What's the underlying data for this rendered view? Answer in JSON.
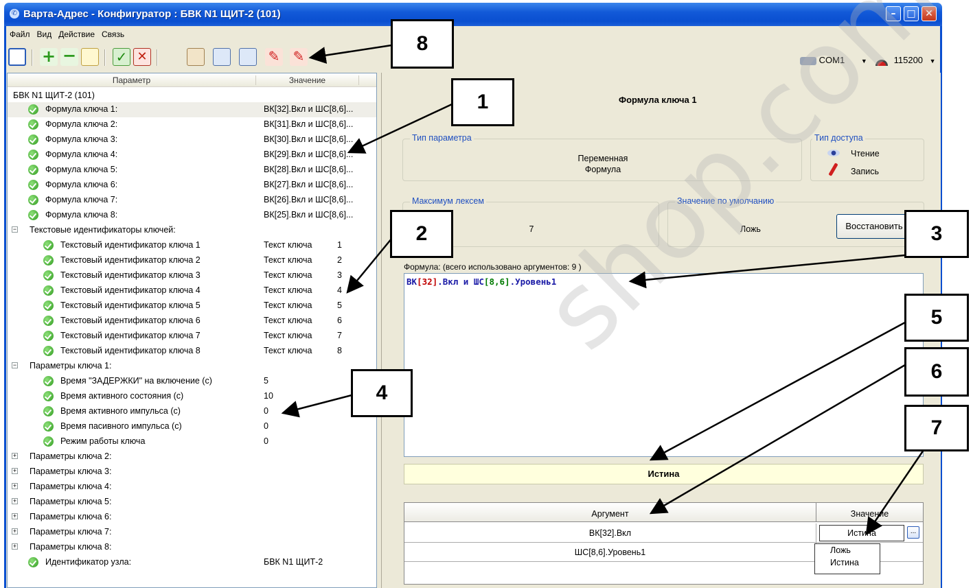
{
  "window": {
    "title": "Варта-Адрес - Конфигуратор : БВК N1 ЩИТ-2 (101)"
  },
  "menu": [
    "Файл",
    "Вид",
    "Действие",
    "Связь"
  ],
  "toolbar": {
    "icons": [
      "save-icon",
      "add-icon",
      "remove-icon",
      "list-icon",
      "check-icon",
      "cancel-icon",
      "import-icon",
      "view-icon",
      "view-all-icon",
      "write-icon",
      "write-all-icon"
    ],
    "port": "COM1",
    "speed": "115200"
  },
  "tree": {
    "header": {
      "param": "Параметр",
      "value": "Значение"
    },
    "root": "БВК N1 ЩИТ-2 (101)",
    "formulas": [
      {
        "label": "Формула ключа 1:",
        "value": "ВК[32].Вкл и ШС[8,6]..."
      },
      {
        "label": "Формула ключа 2:",
        "value": "ВК[31].Вкл и ШС[8,6]..."
      },
      {
        "label": "Формула ключа 3:",
        "value": "ВК[30].Вкл и ШС[8,6]..."
      },
      {
        "label": "Формула ключа 4:",
        "value": "ВК[29].Вкл и ШС[8,6]..."
      },
      {
        "label": "Формула ключа 5:",
        "value": "ВК[28].Вкл и ШС[8,6]..."
      },
      {
        "label": "Формула ключа 6:",
        "value": "ВК[27].Вкл и ШС[8,6]..."
      },
      {
        "label": "Формула ключа 7:",
        "value": "ВК[26].Вкл и ШС[8,6]..."
      },
      {
        "label": "Формула ключа 8:",
        "value": "ВК[25].Вкл и ШС[8,6]..."
      }
    ],
    "text_ids_group": "Текстовые идентификаторы ключей:",
    "text_ids": [
      {
        "label": "Текстовый идентификатор ключа 1",
        "value": "Текст ключа",
        "num": "1"
      },
      {
        "label": "Текстовый идентификатор ключа 2",
        "value": "Текст ключа",
        "num": "2"
      },
      {
        "label": "Текстовый идентификатор ключа 3",
        "value": "Текст ключа",
        "num": "3"
      },
      {
        "label": "Текстовый идентификатор ключа 4",
        "value": "Текст ключа",
        "num": "4"
      },
      {
        "label": "Текстовый идентификатор ключа 5",
        "value": "Текст ключа",
        "num": "5"
      },
      {
        "label": "Текстовый идентификатор ключа 6",
        "value": "Текст ключа",
        "num": "6"
      },
      {
        "label": "Текстовый идентификатор ключа 7",
        "value": "Текст ключа",
        "num": "7"
      },
      {
        "label": "Текстовый идентификатор ключа 8",
        "value": "Текст ключа",
        "num": "8"
      }
    ],
    "key1_group": "Параметры ключа 1:",
    "key1_params": [
      {
        "label": "Время \"ЗАДЕРЖКИ\"  на включение (с)",
        "value": "5"
      },
      {
        "label": "Время активного состояния (с)",
        "value": "10"
      },
      {
        "label": "Время активного импульса (с)",
        "value": "0"
      },
      {
        "label": "Время пасивного импульса (с)",
        "value": "0"
      },
      {
        "label": "Режим работы ключа",
        "value": "0"
      }
    ],
    "collapsed_groups": [
      "Параметры ключа 2:",
      "Параметры ключа 3:",
      "Параметры ключа 4:",
      "Параметры ключа 5:",
      "Параметры ключа 6:",
      "Параметры ключа 7:",
      "Параметры ключа 8:"
    ],
    "node_id": {
      "label": "Идентификатор узла:",
      "value": "БВК N1 ЩИТ-2"
    }
  },
  "details": {
    "title": "Формула ключа 1",
    "param_type": {
      "label": "Тип параметра",
      "line1": "Переменная",
      "line2": "Формула"
    },
    "access_type": {
      "label": "Тип доступа",
      "read": "Чтение",
      "write": "Запись"
    },
    "max_lexemes": {
      "label": "Максимум лексем",
      "value": "7"
    },
    "default_value": {
      "label": "Значение по умолчанию",
      "value": "Ложь"
    },
    "restore_button": "Восстановить",
    "formula_label": "Формула: (всего использовано аргументов: 9 )",
    "formula_parts": [
      "ВК",
      "[32]",
      ".Вкл",
      " и ",
      "ШС",
      "[8,6]",
      ".Уровень1"
    ],
    "result": "Истина",
    "args_table": {
      "headers": [
        "Аргумент",
        "Значение"
      ],
      "rows": [
        {
          "arg": "ВК[32].Вкл",
          "value": "Истина"
        },
        {
          "arg": "ШС[8,6].Уровень1",
          "value": ""
        }
      ]
    },
    "dropdown_options": [
      "Ложь",
      "Истина"
    ]
  },
  "callouts": [
    "1",
    "2",
    "3",
    "4",
    "5",
    "6",
    "7",
    "8"
  ],
  "colors": {
    "title_bar": "#0a4fd0",
    "formula_blue": "#1a1aa6",
    "formula_red": "#c00000",
    "formula_green": "#007a00",
    "link_label": "#1f4fc0"
  }
}
